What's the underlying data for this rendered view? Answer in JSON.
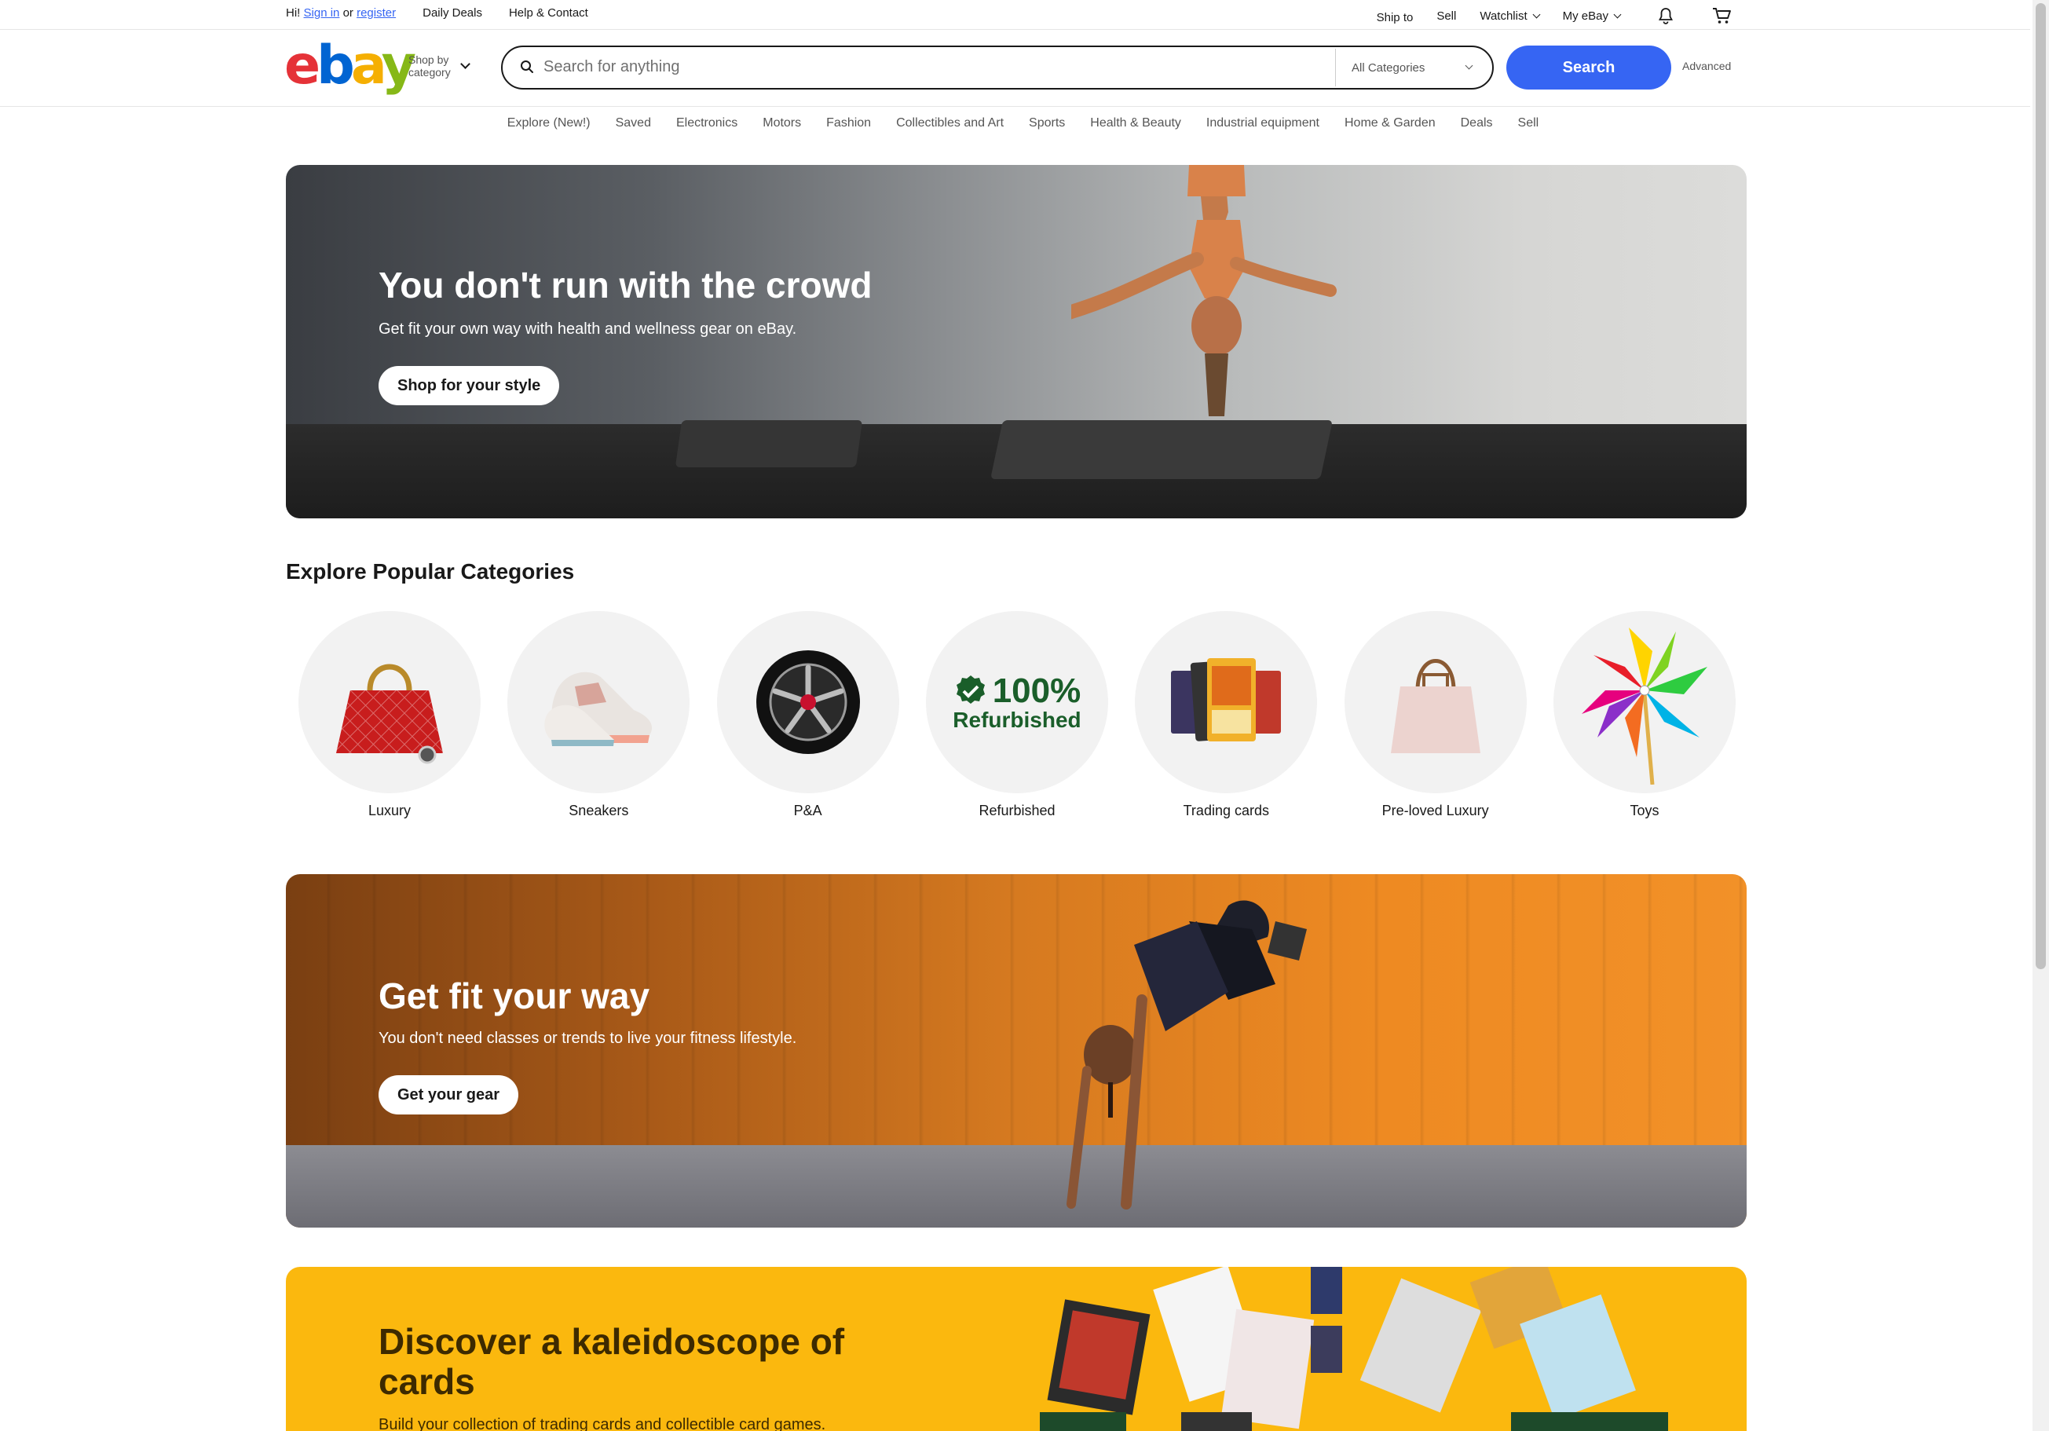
{
  "topbar": {
    "greeting": "Hi!",
    "sign_in": "Sign in",
    "or": "or",
    "register": "register",
    "daily_deals": "Daily Deals",
    "help": "Help & Contact",
    "ship_to": "Ship to",
    "sell": "Sell",
    "watchlist": "Watchlist",
    "my_ebay": "My eBay"
  },
  "header": {
    "logo": {
      "e": "e",
      "b": "b",
      "a": "a",
      "y": "y"
    },
    "shop_by_category_1": "Shop by",
    "shop_by_category_2": "category",
    "search_placeholder": "Search for anything",
    "category_select": "All Categories",
    "search_button": "Search",
    "advanced": "Advanced"
  },
  "nav": {
    "items": [
      "Explore (New!)",
      "Saved",
      "Electronics",
      "Motors",
      "Fashion",
      "Collectibles and Art",
      "Sports",
      "Health & Beauty",
      "Industrial equipment",
      "Home & Garden",
      "Deals",
      "Sell"
    ]
  },
  "banner1": {
    "title": "You don't run with the crowd",
    "subtitle": "Get fit your own way with health and wellness gear on eBay.",
    "cta": "Shop for your style"
  },
  "categories": {
    "title": "Explore Popular Categories",
    "items": [
      "Luxury",
      "Sneakers",
      "P&A",
      "Refurbished",
      "Trading cards",
      "Pre-loved Luxury",
      "Toys"
    ],
    "refurbished_badge_pct": "100%",
    "refurbished_badge_word": "Refurbished"
  },
  "banner2": {
    "title": "Get fit your way",
    "subtitle": "You don't need classes or trends to live your fitness lifestyle.",
    "cta": "Get your gear"
  },
  "banner3": {
    "title": "Discover a kaleidoscope of cards",
    "subtitle": "Build your collection of trading cards and collectible card games."
  },
  "colors": {
    "accent": "#3665f3",
    "logo_red": "#e53238",
    "logo_blue": "#0064d2",
    "logo_yellow": "#f5af02",
    "logo_green": "#86b817",
    "banner3_bg": "#fbb80e"
  }
}
